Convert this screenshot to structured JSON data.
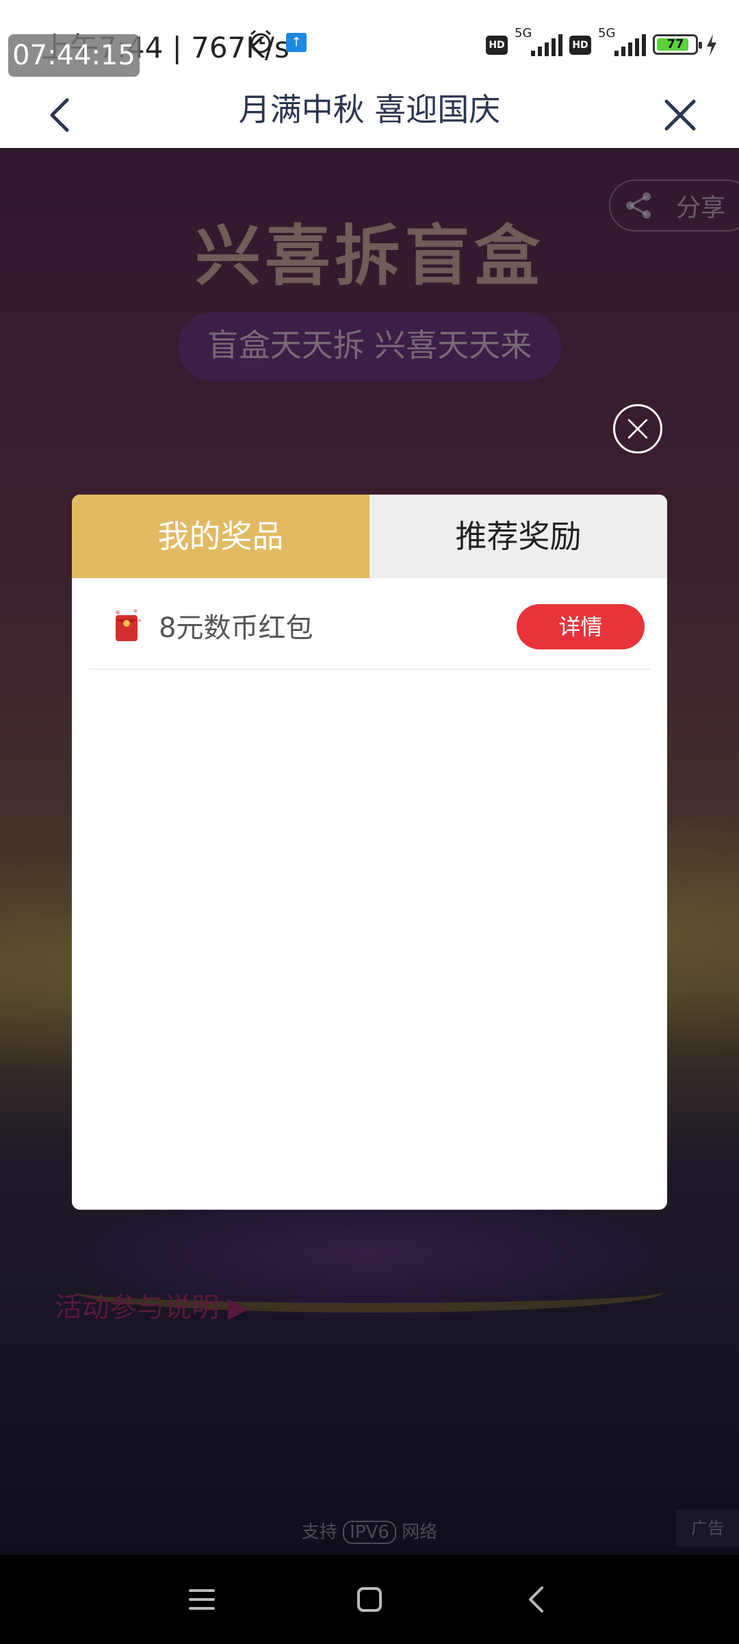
{
  "status_bar": {
    "time": "上午7:44 | 767K/s",
    "overlay_clock": "07:44:15",
    "upload_icon": "upload-icon",
    "hd_label": "HD",
    "network_label": "5G",
    "battery_level": "77"
  },
  "navbar": {
    "title": "月满中秋 喜迎国庆"
  },
  "background": {
    "headline": "兴喜拆盲盒",
    "ribbon": "盲盒天天拆 兴喜天天来",
    "share_label": "分享",
    "rules_link": "活动参与说明 ▶",
    "ipv6_prefix": "支持",
    "ipv6_box": "IPV6",
    "ipv6_suffix": "网络",
    "ad_label": "广告"
  },
  "modal": {
    "tabs": [
      {
        "label": "我的奖品",
        "active": true
      },
      {
        "label": "推荐奖励",
        "active": false
      }
    ],
    "prizes": [
      {
        "name": "8元数币红包",
        "button": "详情"
      }
    ]
  },
  "colors": {
    "tab_active": "#e2ba62",
    "tab_inactive": "#efefef",
    "detail_button": "#e8333a",
    "nav_title": "#2c3550"
  }
}
